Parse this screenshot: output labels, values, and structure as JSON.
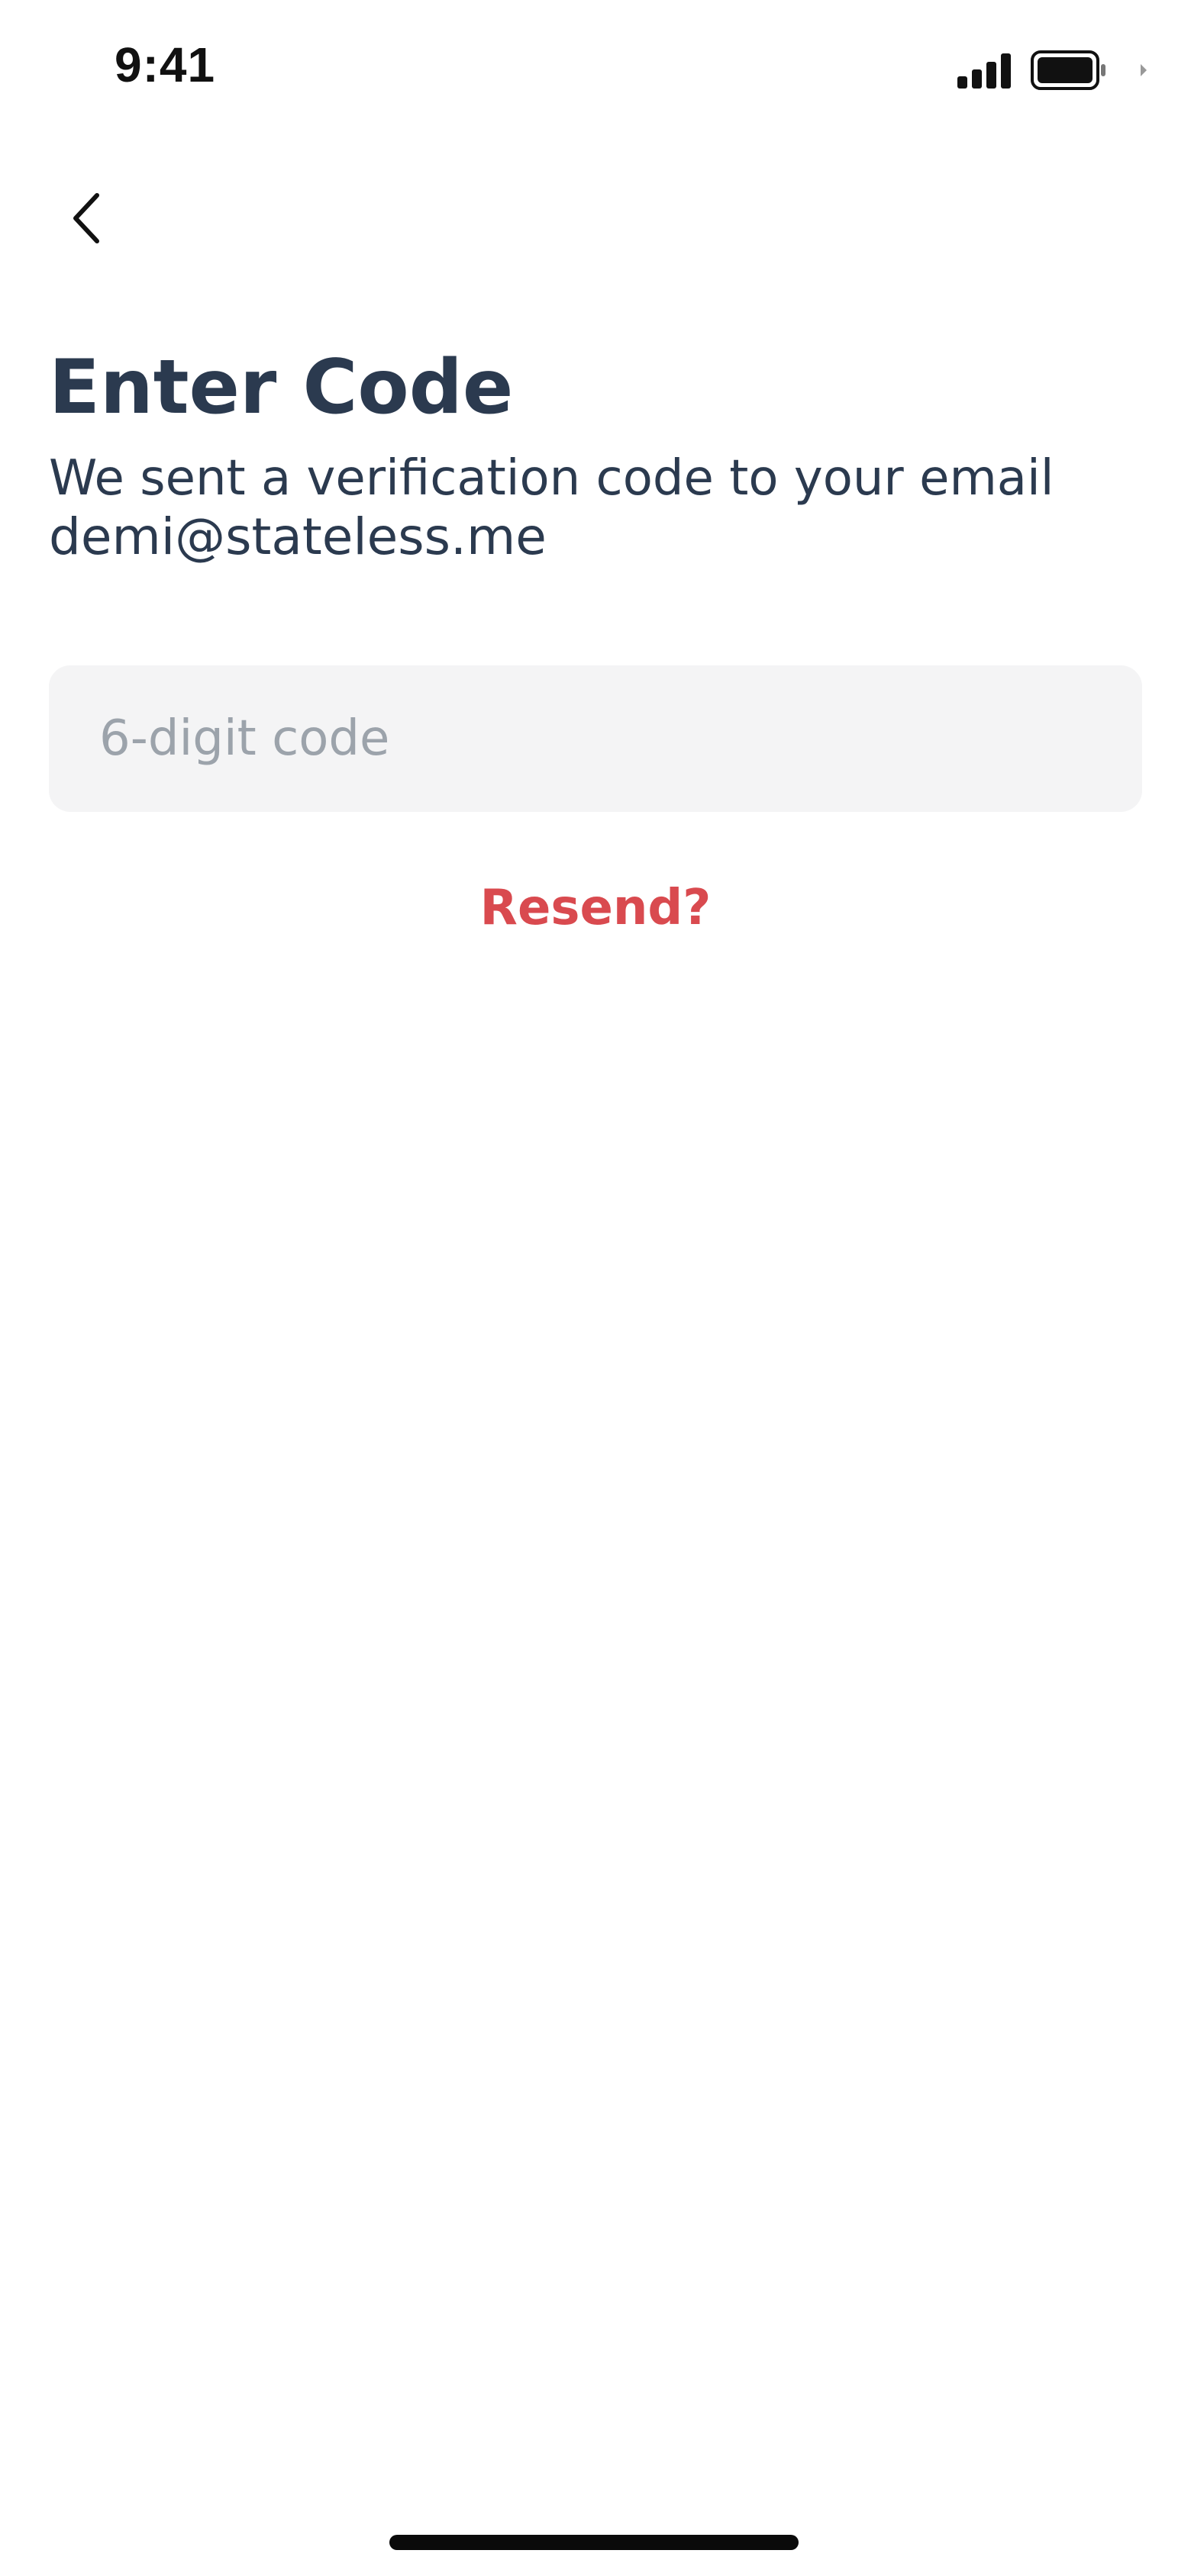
{
  "status_bar": {
    "time": "9:41",
    "icons": [
      "signal-icon",
      "battery-icon"
    ]
  },
  "navigation": {
    "back_icon": "chevron-left-icon"
  },
  "header": {
    "title": "Enter Code",
    "subtitle": "We sent a verification code to your email",
    "email": "demi@stateless.me"
  },
  "code_input": {
    "value": "",
    "placeholder": "6-digit code"
  },
  "resend": {
    "label": "Resend?"
  },
  "colors": {
    "text_primary": "#2b3a4f",
    "accent_red": "#d94a4f",
    "input_background": "#f4f4f5",
    "placeholder": "#9ca3ab",
    "background": "#ffffff"
  }
}
